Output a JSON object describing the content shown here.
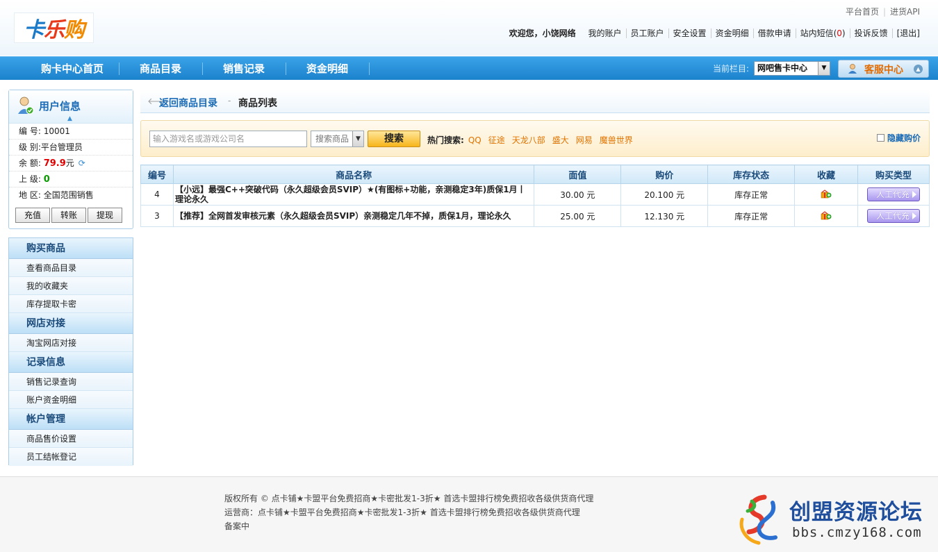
{
  "header": {
    "logo": [
      "卡",
      "乐",
      "购"
    ],
    "top_links": [
      "平台首页",
      "进货API"
    ],
    "welcome": "欢迎您，小饶网络",
    "user_links": [
      "我的账户",
      "员工账户",
      "安全设置",
      "资金明细",
      "借款申请"
    ],
    "messages_label": "站内短信(",
    "messages_count": "0",
    "messages_close": ")",
    "feedback": "投诉反馈",
    "logout": "[退出]"
  },
  "nav": {
    "items": [
      "购卡中心首页",
      "商品目录",
      "销售记录",
      "资金明细"
    ],
    "current_label": "当前栏目:",
    "current_value": "网吧售卡中心",
    "service": "客服中心"
  },
  "userinfo": {
    "title": "用户信息",
    "id_label": "编 号:",
    "id_value": "10001",
    "level_label": "级 别:",
    "level_value": "平台管理员",
    "balance_label": "余 额:",
    "balance_value": "79.9",
    "balance_unit": "元",
    "parent_label": "上 级:",
    "parent_value": "0",
    "region_label": "地 区:",
    "region_value": "全国范围销售",
    "buttons": [
      "充值",
      "转账",
      "提现"
    ]
  },
  "menu": {
    "sections": [
      {
        "title": "购买商品",
        "items": [
          "查看商品目录",
          "我的收藏夹",
          "库存提取卡密"
        ]
      },
      {
        "title": "网店对接",
        "items": [
          "淘宝网店对接"
        ]
      },
      {
        "title": "记录信息",
        "items": [
          "销售记录查询",
          "账户资金明细"
        ]
      },
      {
        "title": "帐户管理",
        "items": [
          "商品售价设置",
          "员工结帐登记"
        ]
      }
    ]
  },
  "crumb": {
    "back": "返回商品目录",
    "current": "商品列表"
  },
  "search": {
    "placeholder": "输入游戏名或游戏公司名",
    "type": "搜索商品",
    "button": "搜索",
    "hot_label": "热门搜索:",
    "hot_keywords": [
      "QQ",
      "征途",
      "天龙八部",
      "盛大",
      "网易",
      "魔兽世界"
    ],
    "hide_price": "隐藏购价"
  },
  "table": {
    "headers": [
      "编号",
      "商品名称",
      "面值",
      "购价",
      "库存状态",
      "收藏",
      "购买类型"
    ],
    "rows": [
      {
        "id": "4",
        "name": "【小远】最强C++突破代码（永久超级会员SVIP）★(有图标+功能，亲测稳定3年)质保1月丨理论永久",
        "face": "30.00 元",
        "price": "20.100 元",
        "stock": "库存正常",
        "buy": "人工代充",
        "color": "#0033cc"
      },
      {
        "id": "3",
        "name": "【推荐】全网首发审核元素（永久超级会员SVIP）亲测稳定几年不掉，质保1月，理论永久",
        "face": "25.00 元",
        "price": "12.130 元",
        "stock": "库存正常",
        "buy": "人工代充",
        "color": "#e10000"
      }
    ]
  },
  "footer": {
    "line1": "版权所有 © 点卡铺★卡盟平台免费招商★卡密批发1-3折★ 首选卡盟排行榜免费招收各级供货商代理",
    "line2": "运营商：点卡铺★卡盟平台免费招商★卡密批发1-3折★ 首选卡盟排行榜免费招收各级供货商代理",
    "line3": "备案中",
    "brand": "创盟资源论坛",
    "brand_url": "bbs.cmzy168.com"
  }
}
